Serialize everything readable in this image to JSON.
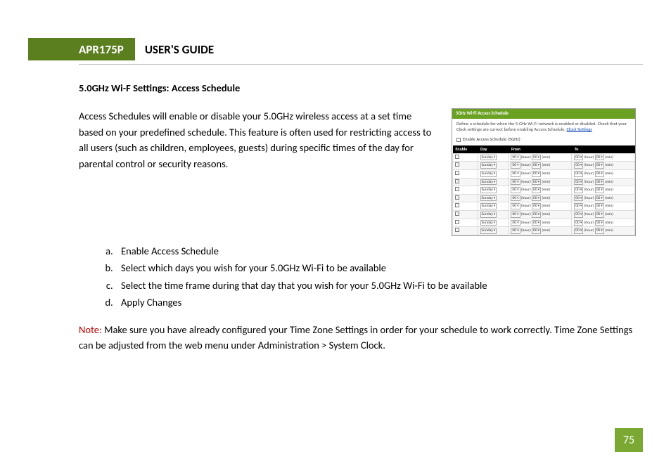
{
  "header": {
    "model": "APR175P",
    "title": "USER'S GUIDE"
  },
  "section_title": "5.0GHz Wi-F Settings: Access Schedule",
  "intro": "Access Schedules will enable or disable your 5.0GHz wireless access at a set time based on your predefined schedule.  This feature is often used for restricting access to all users (such as children, employees, guests) during specific times of the day for parental control or security reasons.",
  "steps": [
    "Enable Access Schedule",
    "Select which days you wish for your 5.0GHz Wi-Fi to be available",
    "Select the time frame during that day that you wish for your 5.0GHz Wi-Fi to be available",
    "Apply Changes"
  ],
  "note": {
    "label": "Note:",
    "text": " Make sure you have already configured your Time Zone Settings in order for your schedule to work correctly. Time Zone Settings can be adjusted from the web menu under Administration > System Clock."
  },
  "page_number": "75",
  "screenshot": {
    "title": "5GHz Wi-Fi Access Schedule",
    "desc_a": "Define a schedule for when the 5-GHz Wi-Fi network is enabled or disabled. Check that your Clock settings are correct before enabling Access Schedule. ",
    "desc_link": "Clock Settings",
    "enable_label": "Enable Access Schedule (5GHz)",
    "col_enable": "Enable",
    "col_day": "Day",
    "col_from": "From",
    "col_to": "To",
    "day_value": "Sunday",
    "hour_value": "00",
    "hour_unit": "(hour)",
    "min_value": "00",
    "min_unit": "(min)",
    "row_count": 10
  }
}
